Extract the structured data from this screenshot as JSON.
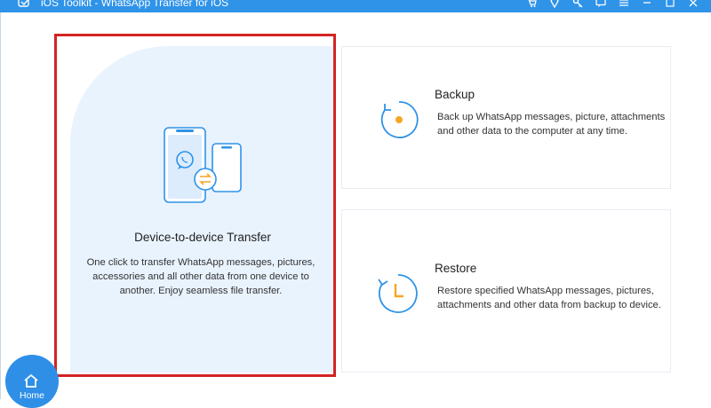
{
  "titlebar": {
    "title": "iOS Toolkit - WhatsApp Transfer for iOS",
    "icons": [
      "cart-icon",
      "diamond-icon",
      "key-icon",
      "feedback-icon",
      "menu-icon",
      "minimize-icon",
      "maximize-icon",
      "close-icon"
    ]
  },
  "device_transfer": {
    "title": "Device-to-device Transfer",
    "description": "One click to transfer WhatsApp messages, pictures, accessories and all other data from one device to another. Enjoy seamless file transfer."
  },
  "backup": {
    "title": "Backup",
    "description": "Back up WhatsApp messages, picture, attachments and other data to the computer at any time."
  },
  "restore": {
    "title": "Restore",
    "description": "Restore specified WhatsApp messages, pictures, attachments and other data from backup to device."
  },
  "home": {
    "label": "Home"
  },
  "colors": {
    "accent": "#2f93e8",
    "highlight": "#d42323",
    "card_bg": "#e9f3fe",
    "icon_orange": "#f5a623"
  }
}
